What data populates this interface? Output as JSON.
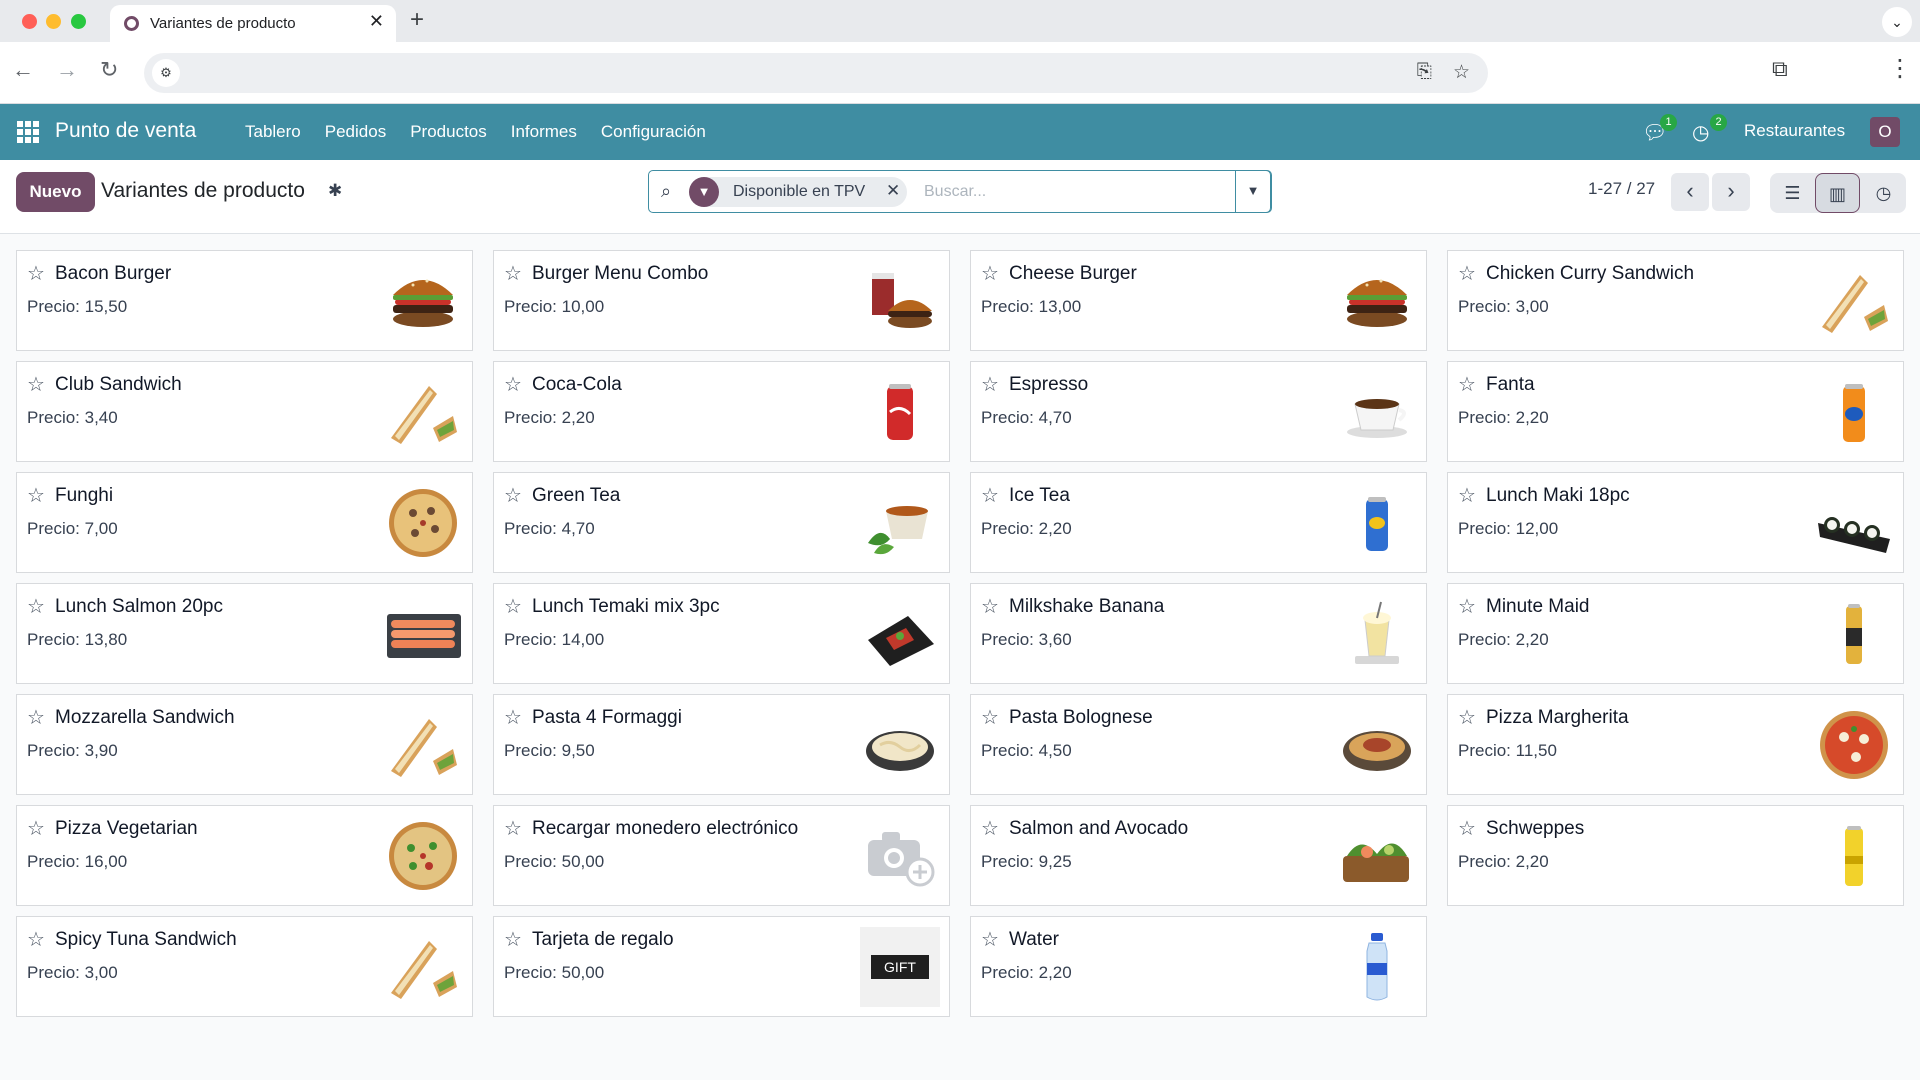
{
  "browser": {
    "tab_title": "Variantes de producto",
    "tab_close": "✕",
    "new_tab": "+"
  },
  "app": {
    "brand": "Punto de venta",
    "menu": [
      {
        "label": "Tablero"
      },
      {
        "label": "Pedidos"
      },
      {
        "label": "Productos"
      },
      {
        "label": "Informes"
      },
      {
        "label": "Configuración"
      }
    ],
    "messages_count": "1",
    "activities_count": "2",
    "company": "Restaurantes",
    "user_initial": "O"
  },
  "control": {
    "new_button": "Nuevo",
    "title": "Variantes de producto",
    "facet_label": "Disponible en TPV",
    "facet_remove": "✕",
    "search_placeholder": "Buscar...",
    "pager": "1-27 / 27"
  },
  "colors": {
    "navbar": "#3f8da2",
    "brand_primary": "#714b67",
    "badge": "#28a745"
  },
  "icons": {
    "tab_favicon": "odoo-circle-icon",
    "favorite": "star-outline-icon",
    "settings": "gear-icon",
    "search": "magnifier-icon",
    "filter": "funnel-icon"
  },
  "products": [
    {
      "name": "Bacon Burger",
      "price": "Precio: 15,50",
      "image": "burger"
    },
    {
      "name": "Burger Menu Combo",
      "price": "Precio: 10,00",
      "image": "combo"
    },
    {
      "name": "Cheese Burger",
      "price": "Precio: 13,00",
      "image": "burger"
    },
    {
      "name": "Chicken Curry Sandwich",
      "price": "Precio: 3,00",
      "image": "sandwich"
    },
    {
      "name": "Club Sandwich",
      "price": "Precio: 3,40",
      "image": "sandwich"
    },
    {
      "name": "Coca-Cola",
      "price": "Precio: 2,20",
      "image": "can-red"
    },
    {
      "name": "Espresso",
      "price": "Precio: 4,70",
      "image": "coffee"
    },
    {
      "name": "Fanta",
      "price": "Precio: 2,20",
      "image": "can-orange"
    },
    {
      "name": "Funghi",
      "price": "Precio: 7,00",
      "image": "pizza-funghi"
    },
    {
      "name": "Green Tea",
      "price": "Precio: 4,70",
      "image": "tea"
    },
    {
      "name": "Ice Tea",
      "price": "Precio: 2,20",
      "image": "can-blue"
    },
    {
      "name": "Lunch Maki 18pc",
      "price": "Precio: 12,00",
      "image": "maki"
    },
    {
      "name": "Lunch Salmon 20pc",
      "price": "Precio: 13,80",
      "image": "salmon"
    },
    {
      "name": "Lunch Temaki mix 3pc",
      "price": "Precio: 14,00",
      "image": "temaki"
    },
    {
      "name": "Milkshake Banana",
      "price": "Precio: 3,60",
      "image": "milkshake"
    },
    {
      "name": "Minute Maid",
      "price": "Precio: 2,20",
      "image": "can-slim"
    },
    {
      "name": "Mozzarella Sandwich",
      "price": "Precio: 3,90",
      "image": "sandwich"
    },
    {
      "name": "Pasta 4 Formaggi",
      "price": "Precio: 9,50",
      "image": "pasta-white"
    },
    {
      "name": "Pasta Bolognese",
      "price": "Precio: 4,50",
      "image": "pasta-red"
    },
    {
      "name": "Pizza Margherita",
      "price": "Precio: 11,50",
      "image": "pizza-margherita"
    },
    {
      "name": "Pizza Vegetarian",
      "price": "Precio: 16,00",
      "image": "pizza-veg"
    },
    {
      "name": "Recargar monedero electrónico",
      "price": "Precio: 50,00",
      "image": "placeholder"
    },
    {
      "name": "Salmon and Avocado",
      "price": "Precio: 9,25",
      "image": "salad"
    },
    {
      "name": "Schweppes",
      "price": "Precio: 2,20",
      "image": "can-yellow"
    },
    {
      "name": "Spicy Tuna Sandwich",
      "price": "Precio: 3,00",
      "image": "sandwich"
    },
    {
      "name": "Tarjeta de regalo",
      "price": "Precio: 50,00",
      "image": "gift",
      "image_text": "GIFT"
    },
    {
      "name": "Water",
      "price": "Precio: 2,20",
      "image": "bottle"
    }
  ]
}
